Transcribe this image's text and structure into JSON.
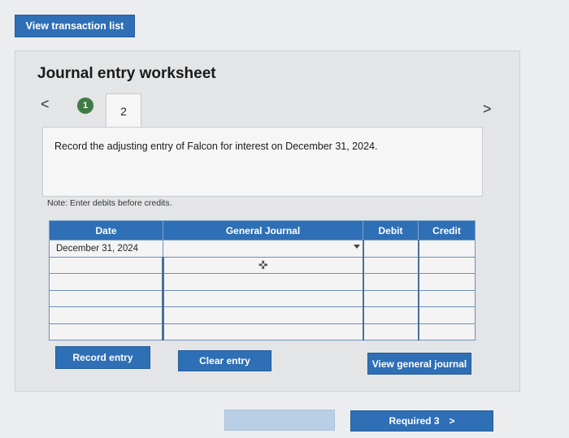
{
  "header": {
    "view_list_label": "View transaction list"
  },
  "worksheet": {
    "title": "Journal entry worksheet",
    "nav": {
      "prev": "<",
      "next": ">",
      "steps": [
        "1",
        "2"
      ]
    },
    "instruction": "Record the adjusting entry of Falcon for interest on December 31, 2024.",
    "note": "Note: Enter debits before credits."
  },
  "table": {
    "headers": [
      "Date",
      "General Journal",
      "Debit",
      "Credit"
    ],
    "rows": [
      {
        "date": "December 31, 2024",
        "account": "",
        "debit": "",
        "credit": ""
      },
      {
        "date": "",
        "account": "",
        "debit": "",
        "credit": ""
      },
      {
        "date": "",
        "account": "",
        "debit": "",
        "credit": ""
      },
      {
        "date": "",
        "account": "",
        "debit": "",
        "credit": ""
      },
      {
        "date": "",
        "account": "",
        "debit": "",
        "credit": ""
      },
      {
        "date": "",
        "account": "",
        "debit": "",
        "credit": ""
      }
    ]
  },
  "actions": {
    "record": "Record entry",
    "clear": "Clear entry",
    "view_journal": "View general journal"
  },
  "footer": {
    "next_label": "Required 3",
    "next_chevron": ">"
  },
  "colors": {
    "primary": "#2f6fb5",
    "step_active": "#3f7b45"
  }
}
